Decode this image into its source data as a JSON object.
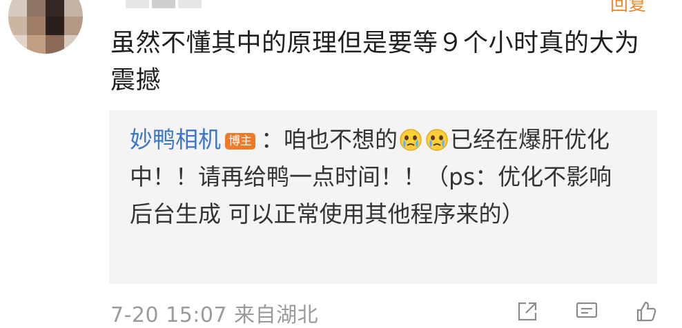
{
  "comment": {
    "text": "虽然不懂其中的原理但是要等９个小时真的大为震撼"
  },
  "top_action_label": "回复",
  "reply": {
    "author": "妙鸭相机",
    "badge": "博主",
    "text_before_emoji": "：咱也不想的",
    "text_after_emoji": "已经在爆肝优化中！！请再给鸭一点时间！！（ps：优化不影响后台生成 可以正常使用其他程序来的）",
    "emoji_icons": [
      "crying-face-emoji",
      "crying-face-emoji"
    ]
  },
  "footer": {
    "meta": "7-20 15:07 来自湖北",
    "icons": [
      "share-icon",
      "comment-icon",
      "like-icon"
    ]
  },
  "colors": {
    "author_link": "#3b77c7",
    "badge_bg": "#f07a28",
    "reply_bg": "#f4f4f4",
    "meta_text": "#9a9a9a"
  }
}
